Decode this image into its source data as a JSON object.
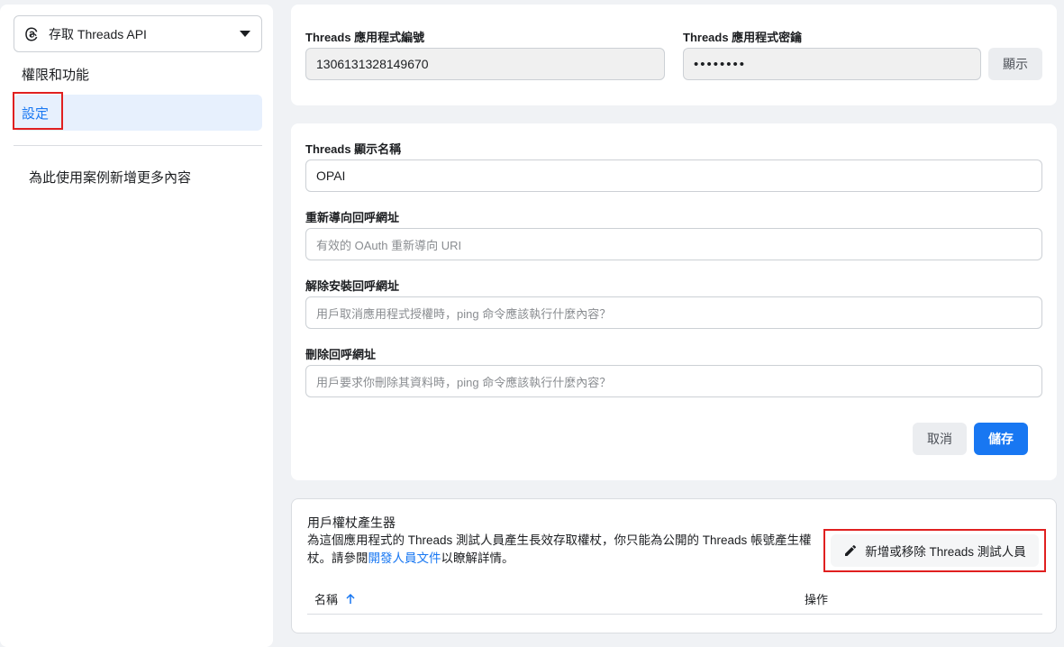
{
  "sidebar": {
    "app_selector": "存取 Threads API",
    "items": [
      {
        "label": "權限和功能"
      },
      {
        "label": "設定"
      }
    ],
    "more_content": "為此使用案例新增更多內容"
  },
  "credentials": {
    "app_id_label": "Threads 應用程式編號",
    "app_id_value": "1306131328149670",
    "app_secret_label": "Threads 應用程式密鑰",
    "app_secret_value": "••••••••",
    "show_button": "顯示"
  },
  "settings_form": {
    "display_name_label": "Threads 顯示名稱",
    "display_name_value": "OPAI",
    "redirect_label": "重新導向回呼網址",
    "redirect_placeholder": "有效的 OAuth 重新導向 URI",
    "uninstall_label": "解除安裝回呼網址",
    "uninstall_placeholder": "用戶取消應用程式授權時，ping 命令應該執行什麼內容？",
    "delete_label": "刪除回呼網址",
    "delete_placeholder": "用戶要求你刪除其資料時，ping 命令應該執行什麼內容？",
    "cancel_button": "取消",
    "save_button": "儲存"
  },
  "token_generator": {
    "title": "用戶權杖產生器",
    "desc_part1": "為這個應用程式的 Threads 測試人員產生長效存取權杖，你只能為公開的 Threads 帳號產生權杖。請參閱",
    "desc_link": "開發人員文件",
    "desc_part2": "以瞭解詳情。",
    "tester_button": "新增或移除 Threads 測試人員",
    "col_name": "名稱",
    "col_action": "操作"
  },
  "colors": {
    "accent": "#1877f2",
    "highlight": "#e02020",
    "page_bg": "#f0f2f5"
  }
}
